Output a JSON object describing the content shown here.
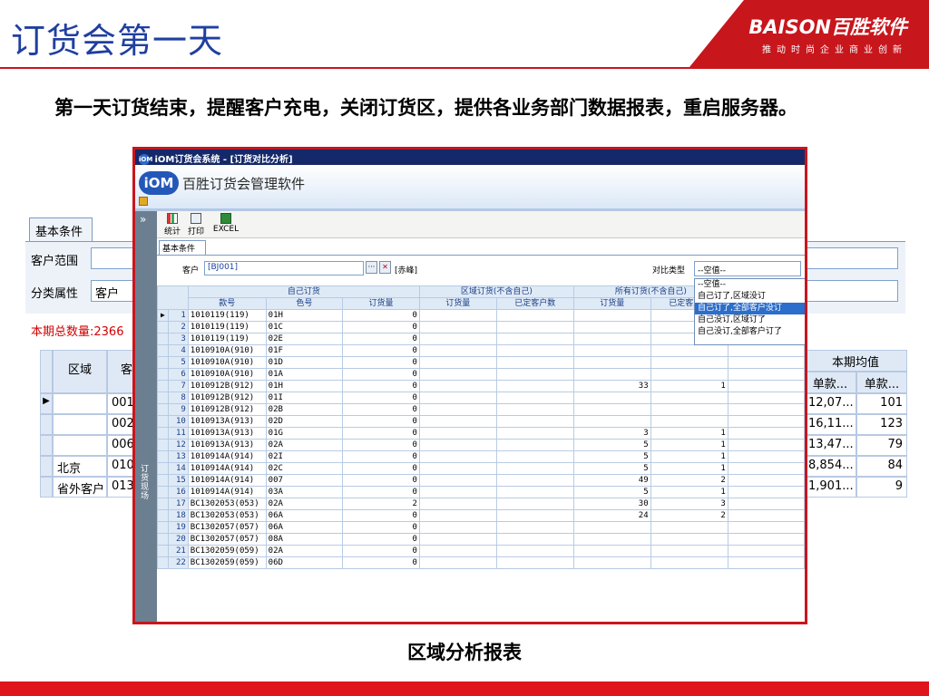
{
  "slide": {
    "title": "订货会第一天",
    "brand": "BAISON百胜软件",
    "brand_slogan": "推动时尚企业商业创新",
    "description": "第一天订货结束，提醒客户充电，关闭订货区，提供各业务部门数据报表，重启服务器。",
    "caption": "区域分析报表",
    "colors": {
      "title": "#1f3fa0",
      "brand_red": "#c8161d",
      "window_border": "#c8161d"
    }
  },
  "background": {
    "tab": "基本条件",
    "customer_range_label": "客户范围",
    "category_label": "分类属性",
    "category_value": "客户",
    "total": "本期总数量:2366",
    "grid_headers": {
      "region": "区域",
      "customer": "客户",
      "period_avg": "本期均值",
      "unit1": "单款...",
      "unit2": "单款..."
    },
    "rows": [
      {
        "indicator": "▶",
        "region": "",
        "customer": "001",
        "v1": "12,07...",
        "v2": "101"
      },
      {
        "indicator": "",
        "region": "",
        "customer": "002",
        "v1": "16,11...",
        "v2": "123"
      },
      {
        "indicator": "",
        "region": "",
        "customer": "006",
        "v1": "13,47...",
        "v2": "79"
      },
      {
        "indicator": "",
        "region": "北京",
        "customer": "010",
        "v1": "8,854...",
        "v2": "84"
      },
      {
        "indicator": "",
        "region": "省外客户",
        "customer": "013",
        "v1": "1,901...",
        "v2": "9"
      }
    ]
  },
  "window": {
    "title": "iOM订货会系统 - [订货对比分析]",
    "app_icon": "iOM",
    "logo": "iOM",
    "logo_text": "百胜订货会管理软件",
    "collapse": "»",
    "side_label": "订货现场",
    "toolbar": [
      {
        "label": "统计",
        "icon": "chart-icon"
      },
      {
        "label": "打印",
        "icon": "printer-icon"
      },
      {
        "label": "EXCEL",
        "icon": "excel-icon"
      }
    ],
    "sub_tab": "基本条件",
    "customer_label": "客户",
    "customer_value": "[BJ001]",
    "ellipsis": "···",
    "clear": "✕",
    "customer_name": "[赤峰]",
    "compare_label": "对比类型",
    "compare_value": "--空值--",
    "compare_options": [
      "--空值--",
      "自己订了,区域没订",
      "自己订了,全部客户没订",
      "自己没订,区域订了",
      "自己没订,全部客户订了"
    ],
    "compare_selected_index": 2,
    "group_headers": [
      "自己订货",
      "区域订货(不含自己)",
      "所有订货(不含自己)"
    ],
    "columns": [
      "款号",
      "色号",
      "订货量",
      "订货量",
      "已定客户数",
      "订货量",
      "已定客户数"
    ],
    "rows": [
      {
        "n": "1",
        "style": "1010119(119)",
        "color": "01H",
        "own": "0",
        "reg_qty": "",
        "reg_cust": "",
        "all_qty": "",
        "all_cust": ""
      },
      {
        "n": "2",
        "style": "1010119(119)",
        "color": "01C",
        "own": "0",
        "reg_qty": "",
        "reg_cust": "",
        "all_qty": "",
        "all_cust": ""
      },
      {
        "n": "3",
        "style": "1010119(119)",
        "color": "02E",
        "own": "0",
        "reg_qty": "",
        "reg_cust": "",
        "all_qty": "",
        "all_cust": ""
      },
      {
        "n": "4",
        "style": "1010910A(910)",
        "color": "01F",
        "own": "0",
        "reg_qty": "",
        "reg_cust": "",
        "all_qty": "",
        "all_cust": ""
      },
      {
        "n": "5",
        "style": "1010910A(910)",
        "color": "01D",
        "own": "0",
        "reg_qty": "",
        "reg_cust": "",
        "all_qty": "",
        "all_cust": ""
      },
      {
        "n": "6",
        "style": "1010910A(910)",
        "color": "01A",
        "own": "0",
        "reg_qty": "",
        "reg_cust": "",
        "all_qty": "",
        "all_cust": ""
      },
      {
        "n": "7",
        "style": "1010912B(912)",
        "color": "01H",
        "own": "0",
        "reg_qty": "",
        "reg_cust": "",
        "all_qty": "33",
        "all_cust": "1"
      },
      {
        "n": "8",
        "style": "1010912B(912)",
        "color": "01I",
        "own": "0",
        "reg_qty": "",
        "reg_cust": "",
        "all_qty": "",
        "all_cust": ""
      },
      {
        "n": "9",
        "style": "1010912B(912)",
        "color": "02B",
        "own": "0",
        "reg_qty": "",
        "reg_cust": "",
        "all_qty": "",
        "all_cust": ""
      },
      {
        "n": "10",
        "style": "1010913A(913)",
        "color": "02D",
        "own": "0",
        "reg_qty": "",
        "reg_cust": "",
        "all_qty": "",
        "all_cust": ""
      },
      {
        "n": "11",
        "style": "1010913A(913)",
        "color": "01G",
        "own": "0",
        "reg_qty": "",
        "reg_cust": "",
        "all_qty": "3",
        "all_cust": "1"
      },
      {
        "n": "12",
        "style": "1010913A(913)",
        "color": "02A",
        "own": "0",
        "reg_qty": "",
        "reg_cust": "",
        "all_qty": "5",
        "all_cust": "1"
      },
      {
        "n": "13",
        "style": "1010914A(914)",
        "color": "02I",
        "own": "0",
        "reg_qty": "",
        "reg_cust": "",
        "all_qty": "5",
        "all_cust": "1"
      },
      {
        "n": "14",
        "style": "1010914A(914)",
        "color": "02C",
        "own": "0",
        "reg_qty": "",
        "reg_cust": "",
        "all_qty": "5",
        "all_cust": "1"
      },
      {
        "n": "15",
        "style": "1010914A(914)",
        "color": "007",
        "own": "0",
        "reg_qty": "",
        "reg_cust": "",
        "all_qty": "49",
        "all_cust": "2"
      },
      {
        "n": "16",
        "style": "1010914A(914)",
        "color": "03A",
        "own": "0",
        "reg_qty": "",
        "reg_cust": "",
        "all_qty": "5",
        "all_cust": "1"
      },
      {
        "n": "17",
        "style": "BC1302053(053)",
        "color": "02A",
        "own": "2",
        "reg_qty": "",
        "reg_cust": "",
        "all_qty": "30",
        "all_cust": "3"
      },
      {
        "n": "18",
        "style": "BC1302053(053)",
        "color": "06A",
        "own": "0",
        "reg_qty": "",
        "reg_cust": "",
        "all_qty": "24",
        "all_cust": "2"
      },
      {
        "n": "19",
        "style": "BC1302057(057)",
        "color": "06A",
        "own": "0",
        "reg_qty": "",
        "reg_cust": "",
        "all_qty": "",
        "all_cust": ""
      },
      {
        "n": "20",
        "style": "BC1302057(057)",
        "color": "08A",
        "own": "0",
        "reg_qty": "",
        "reg_cust": "",
        "all_qty": "",
        "all_cust": ""
      },
      {
        "n": "21",
        "style": "BC1302059(059)",
        "color": "02A",
        "own": "0",
        "reg_qty": "",
        "reg_cust": "",
        "all_qty": "",
        "all_cust": ""
      },
      {
        "n": "22",
        "style": "BC1302059(059)",
        "color": "06D",
        "own": "0",
        "reg_qty": "",
        "reg_cust": "",
        "all_qty": "",
        "all_cust": ""
      }
    ]
  }
}
